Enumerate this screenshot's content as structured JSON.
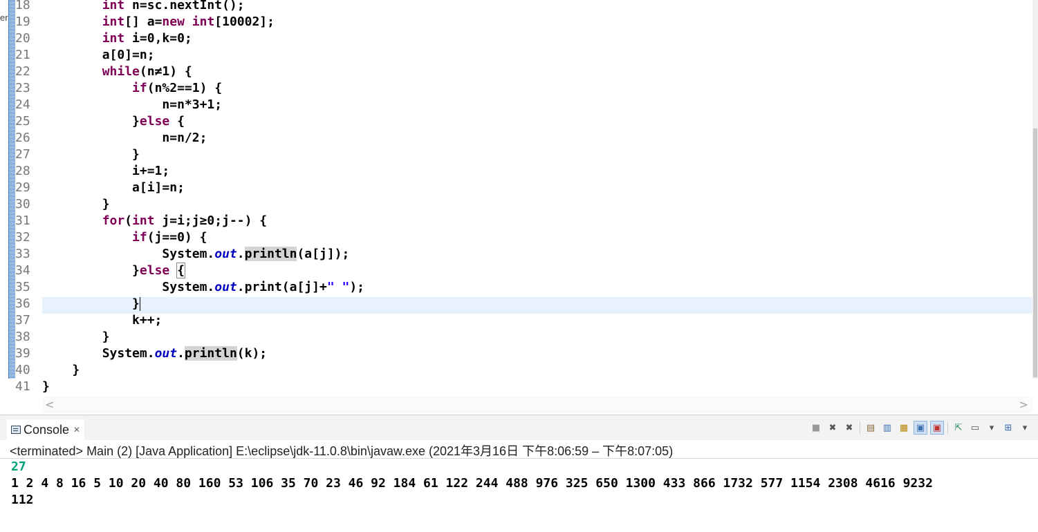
{
  "editor": {
    "left_edge_text": "er",
    "line_numbers": [
      "18",
      "19",
      "20",
      "21",
      "22",
      "23",
      "24",
      "25",
      "26",
      "27",
      "28",
      "29",
      "30",
      "31",
      "32",
      "33",
      "34",
      "35",
      "36",
      "37",
      "38",
      "39",
      "40",
      "41"
    ]
  },
  "code": {
    "l18": {
      "indent": "        ",
      "kw": "int",
      "rest": " n=sc.nextInt();"
    },
    "l19": {
      "indent": "        ",
      "kw1": "int",
      "mid": "[] a=",
      "kw2": "new",
      "sp": " ",
      "kw3": "int",
      "rest": "[10002];"
    },
    "l20": {
      "indent": "        ",
      "kw": "int",
      "rest": " i=0,k=0;"
    },
    "l21": {
      "indent": "        ",
      "text": "a[0]=n;"
    },
    "l22": {
      "indent": "        ",
      "kw": "while",
      "rest": "(n≠1) {"
    },
    "l23": {
      "indent": "            ",
      "kw": "if",
      "rest": "(n%2==1) {"
    },
    "l24": {
      "indent": "                ",
      "text": "n=n*3+1;"
    },
    "l25": {
      "indent": "            ",
      "pre": "}",
      "kw": "else",
      "rest": " {"
    },
    "l26": {
      "indent": "                ",
      "text": "n=n/2;"
    },
    "l27": {
      "indent": "            ",
      "text": "}"
    },
    "l28": {
      "indent": "            ",
      "text": "i+=1;"
    },
    "l29": {
      "indent": "            ",
      "text": "a[i]=n;"
    },
    "l30": {
      "indent": "        ",
      "text": "}"
    },
    "l31": {
      "indent": "        ",
      "kw": "for",
      "p1": "(",
      "kw2": "int",
      "rest": " j=i;j≥0;j--) {"
    },
    "l32": {
      "indent": "            ",
      "kw": "if",
      "rest": "(j==0) {"
    },
    "l33": {
      "indent": "                ",
      "cls": "System.",
      "fld": "out",
      "dot": ".",
      "method": "println",
      "rest": "(a[j]);"
    },
    "l34": {
      "indent": "            ",
      "pre": "}",
      "kw": "else",
      "sp": " ",
      "brace": "{"
    },
    "l35": {
      "indent": "                ",
      "cls": "System.",
      "fld": "out",
      "mid": ".print(a[j]+",
      "str": "\" \"",
      "rest": ");"
    },
    "l36": {
      "indent": "            ",
      "text": "}"
    },
    "l37": {
      "indent": "            ",
      "text": "k++;"
    },
    "l38": {
      "indent": "        ",
      "text": "}"
    },
    "l39": {
      "indent": "        ",
      "cls": "System.",
      "fld": "out",
      "dot": ".",
      "method": "println",
      "rest": "(k);"
    },
    "l40": {
      "indent": "    ",
      "text": "}"
    },
    "l41": {
      "indent": "",
      "text": "}"
    }
  },
  "scrollbar": {
    "left_arrow": "<",
    "right_arrow": ">"
  },
  "console": {
    "tab_label": "Console",
    "close_glyph": "✕",
    "status": "<terminated> Main (2) [Java Application] E:\\eclipse\\jdk-11.0.8\\bin\\javaw.exe  (2021年3月16日 下午8:06:59 – 下午8:07:05)",
    "input": "27",
    "sequence": "1 2 4 8 16 5 10 20 40 80 160 53 106 35 70 23 46 92 184 61 122 244 488 976 325 650 1300 433 866 1732 577 1154 2308 4616 9232",
    "count": "112",
    "toolbar": [
      {
        "name": "terminate-icon",
        "glyph": "■"
      },
      {
        "name": "remove-launch-icon",
        "glyph": "✖"
      },
      {
        "name": "remove-all-terminated-icon",
        "glyph": "✖"
      },
      {
        "name": "clear-console-icon",
        "glyph": "▤"
      },
      {
        "name": "scroll-lock-icon",
        "glyph": "▥"
      },
      {
        "name": "word-wrap-icon",
        "glyph": "▦"
      },
      {
        "name": "show-on-stdout-icon",
        "glyph": "▣"
      },
      {
        "name": "show-on-stderr-icon",
        "glyph": "▣"
      },
      {
        "name": "pin-console-icon",
        "glyph": "⇱"
      },
      {
        "name": "display-console-icon",
        "glyph": "▭"
      },
      {
        "name": "display-console-menu-icon",
        "glyph": "▾"
      },
      {
        "name": "open-console-icon",
        "glyph": "⊞"
      },
      {
        "name": "view-menu-icon",
        "glyph": "▾"
      }
    ]
  }
}
